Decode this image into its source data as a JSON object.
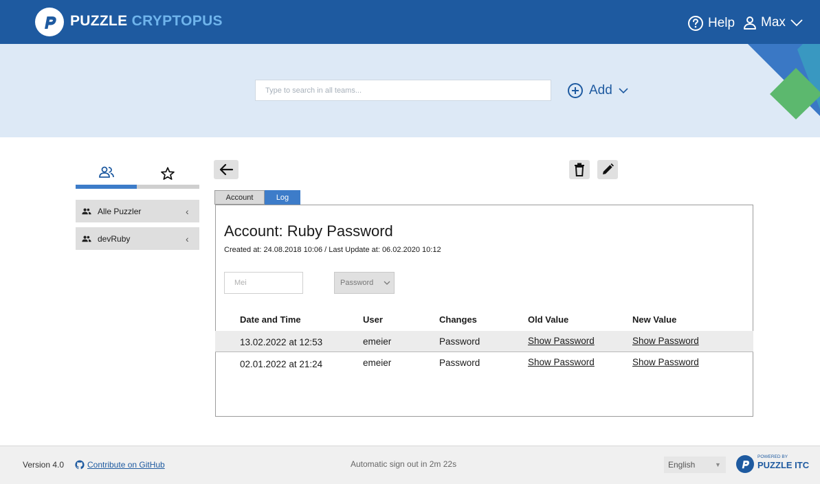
{
  "colors": {
    "brand": "#1e5aa0",
    "accent": "#3d7cc9",
    "hero_bg": "#dde9f6",
    "green": "#5cb86e"
  },
  "header": {
    "brand_part1": "PUZZLE",
    "brand_part2": "CRYPTOPUS",
    "help_label": "Help",
    "user_label": "Max"
  },
  "hero": {
    "search_placeholder": "Type to search in all teams...",
    "add_label": "Add"
  },
  "sidebar": {
    "tabs": [
      {
        "icon": "teams-icon",
        "active": true
      },
      {
        "icon": "star-icon",
        "active": false
      }
    ],
    "teams": [
      {
        "label": "Alle Puzzler",
        "icon": "group-icon"
      },
      {
        "label": "devRuby",
        "icon": "group-icon"
      }
    ]
  },
  "detail": {
    "tabs": {
      "account": "Account",
      "log": "Log"
    },
    "title": "Account: Ruby Password",
    "meta": "Created at: 24.08.2018 10:06 / Last Update at: 06.02.2020 10:12",
    "filter": {
      "user_value": "",
      "user_placeholder": "Mei",
      "type_value": "Password"
    },
    "table": {
      "headers": [
        "Date and Time",
        "User",
        "Changes",
        "Old Value",
        "New Value"
      ],
      "rows": [
        [
          "13.02.2022 at 12:53",
          "emeier",
          "Password",
          "Show Password",
          "Show Password"
        ],
        [
          "02.01.2022 at 21:24",
          "emeier",
          "Password",
          "Show Password",
          "Show Password"
        ]
      ]
    }
  },
  "footer": {
    "version": "Version 4.0",
    "github_label": "Contribute on GitHub",
    "signout": "Automatic sign out in 2m 22s",
    "language": "English",
    "powered_small": "POWERED BY",
    "powered_brand": "PUZZLE ITC"
  }
}
